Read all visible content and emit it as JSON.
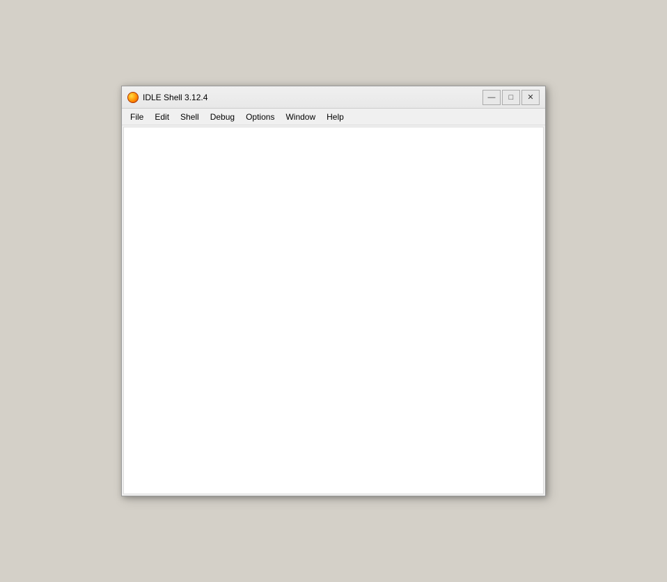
{
  "window": {
    "title": "IDLE Shell 3.12.4",
    "icon_label": "idle-icon"
  },
  "titlebar": {
    "minimize_label": "—",
    "maximize_label": "□",
    "close_label": "✕"
  },
  "menubar": {
    "items": [
      {
        "id": "file",
        "label": "File"
      },
      {
        "id": "edit",
        "label": "Edit"
      },
      {
        "id": "shell",
        "label": "Shell"
      },
      {
        "id": "debug",
        "label": "Debug"
      },
      {
        "id": "options",
        "label": "Options"
      },
      {
        "id": "window",
        "label": "Window"
      },
      {
        "id": "help",
        "label": "Help"
      }
    ]
  }
}
